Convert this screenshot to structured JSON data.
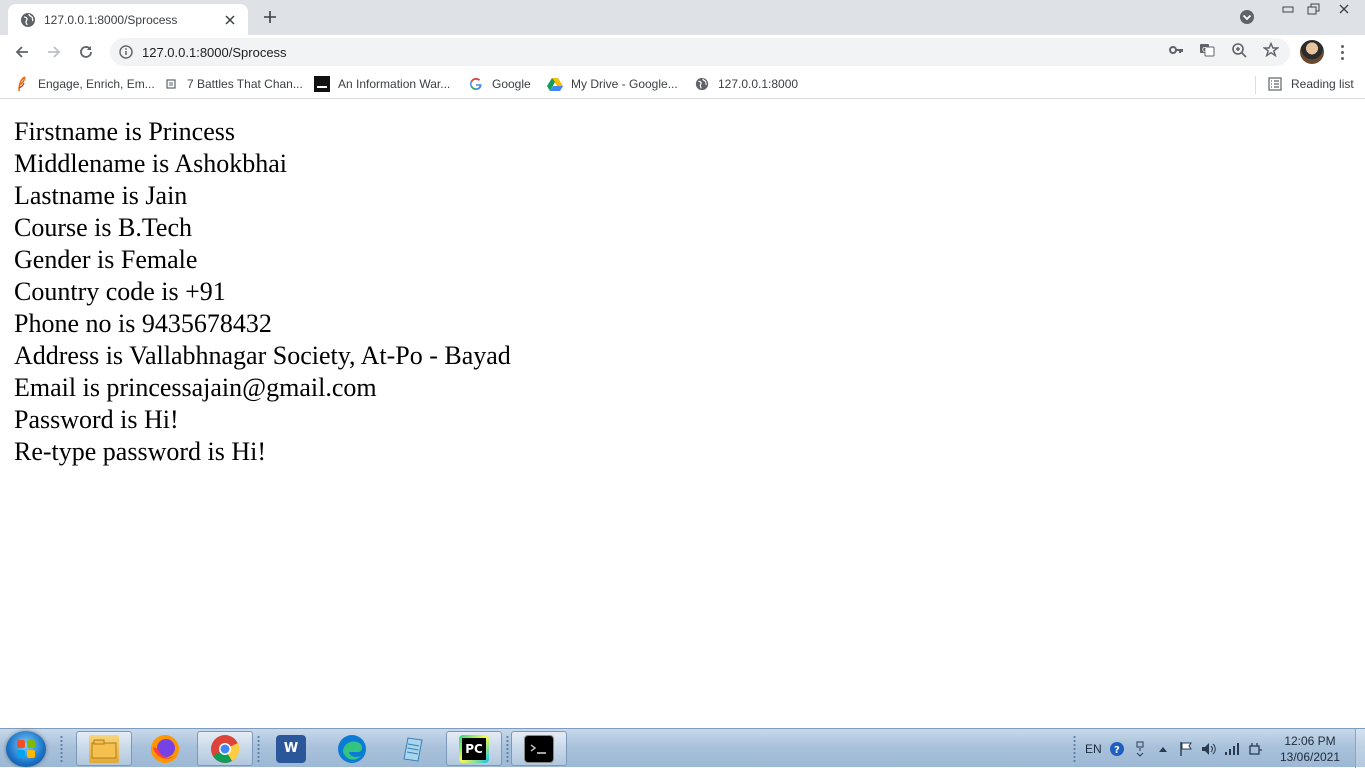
{
  "browser": {
    "tab": {
      "title": "127.0.0.1:8000/Sprocess"
    },
    "address": {
      "url": "127.0.0.1:8000/Sprocess"
    },
    "bookmarks": [
      {
        "label": "Engage, Enrich, Em...",
        "icon": "feather-icon"
      },
      {
        "label": "7 Battles That Chan...",
        "icon": "page-icon"
      },
      {
        "label": "An Information War...",
        "icon": "black-square-icon"
      },
      {
        "label": "Google",
        "icon": "google-icon"
      },
      {
        "label": "My Drive - Google...",
        "icon": "drive-icon"
      },
      {
        "label": "127.0.0.1:8000",
        "icon": "globe-icon"
      }
    ],
    "reading_list": "Reading list"
  },
  "page": {
    "lines": [
      "Firstname is Princess",
      "Middlename is Ashokbhai",
      "Lastname is Jain",
      "Course is B.Tech",
      "Gender is Female",
      "Country code is +91",
      "Phone no is 9435678432",
      "Address is Vallabhnagar Society, At-Po - Bayad",
      "Email is princessajain@gmail.com",
      "Password is Hi!",
      "Re-type password is Hi!"
    ]
  },
  "taskbar": {
    "apps": [
      "file-explorer-icon",
      "firefox-icon",
      "chrome-icon",
      "word-icon",
      "edge-icon",
      "notepad-icon",
      "pycharm-icon",
      "cmd-icon"
    ],
    "pycharm_label": "PC",
    "word_label": "W",
    "language": "EN",
    "clock": {
      "time": "12:06 PM",
      "date": "13/06/2021"
    }
  }
}
